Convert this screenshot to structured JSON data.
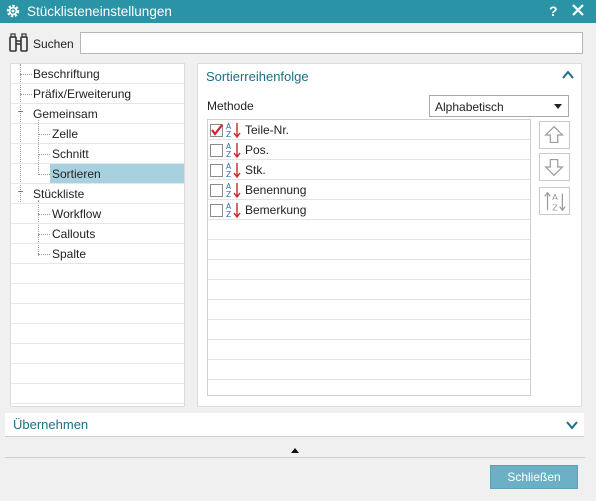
{
  "window": {
    "title": "Stücklisteneinstellungen",
    "help_label": "?",
    "icons": {
      "app": "gear-icon",
      "close": "close-icon"
    }
  },
  "search": {
    "label": "Suchen",
    "value": "",
    "icon": "binoculars-icon"
  },
  "tree": {
    "items": [
      {
        "label": "Beschriftung",
        "level": 1,
        "expander": ""
      },
      {
        "label": "Präfix/Erweiterung",
        "level": 1,
        "expander": ""
      },
      {
        "label": "Gemeinsam",
        "level": 1,
        "expander": "minus"
      },
      {
        "label": "Zelle",
        "level": 2,
        "expander": ""
      },
      {
        "label": "Schnitt",
        "level": 2,
        "expander": ""
      },
      {
        "label": "Sortieren",
        "level": 2,
        "expander": "",
        "selected": true
      },
      {
        "label": "Stückliste",
        "level": 1,
        "expander": "minus"
      },
      {
        "label": "Workflow",
        "level": 2,
        "expander": ""
      },
      {
        "label": "Callouts",
        "level": 2,
        "expander": ""
      },
      {
        "label": "Spalte",
        "level": 2,
        "expander": ""
      }
    ]
  },
  "panel": {
    "title": "Sortierreihenfolge",
    "method_label": "Methode",
    "method_value": "Alphabetisch",
    "sort_items": [
      {
        "label": "Teile-Nr.",
        "checked": true
      },
      {
        "label": "Pos.",
        "checked": false
      },
      {
        "label": "Stk.",
        "checked": false
      },
      {
        "label": "Benennung",
        "checked": false
      },
      {
        "label": "Bemerkung",
        "checked": false
      }
    ],
    "side_buttons": [
      "move-up-icon",
      "move-down-icon",
      "sort-az-icon"
    ]
  },
  "apply": {
    "label": "Übernehmen"
  },
  "footer": {
    "close_label": "Schließen"
  },
  "colors": {
    "titlebar": "#2a93a5",
    "accent_text": "#1b6f86",
    "selection": "#a8d1df",
    "primary_button": "#6cb0c6",
    "check_red": "#d0202a"
  }
}
